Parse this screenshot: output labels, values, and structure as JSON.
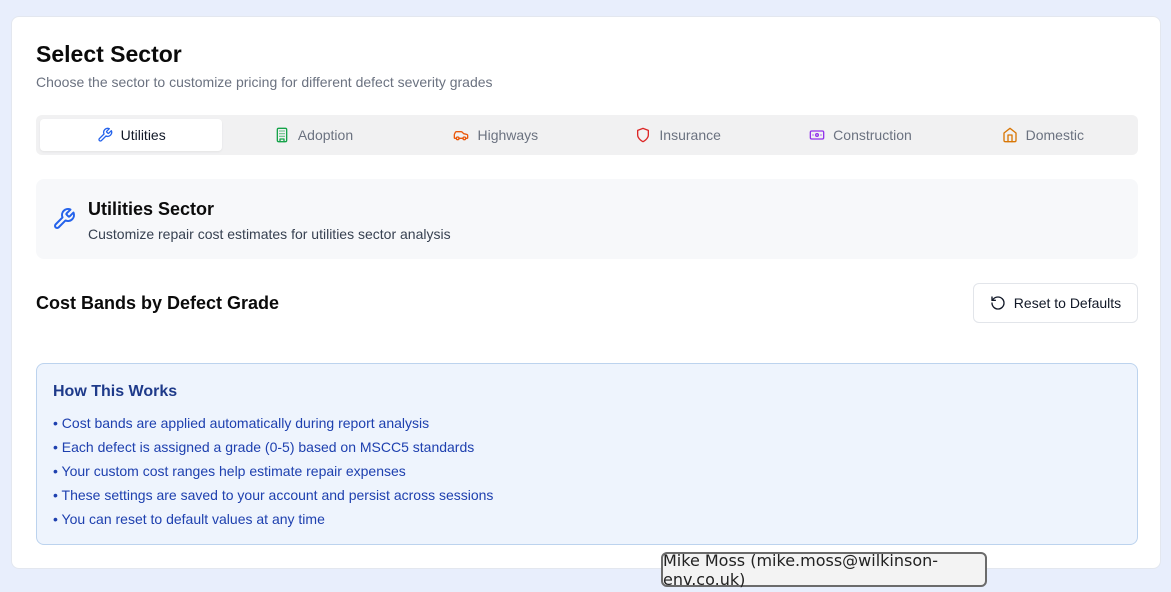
{
  "header": {
    "title": "Select Sector",
    "subtitle": "Choose the sector to customize pricing for different defect severity grades"
  },
  "tabs": [
    {
      "label": "Utilities",
      "icon": "wrench-icon",
      "color": "#2563eb",
      "active": true
    },
    {
      "label": "Adoption",
      "icon": "building-icon",
      "color": "#16a34a",
      "active": false
    },
    {
      "label": "Highways",
      "icon": "car-icon",
      "color": "#ea580c",
      "active": false
    },
    {
      "label": "Insurance",
      "icon": "shield-icon",
      "color": "#dc2626",
      "active": false
    },
    {
      "label": "Construction",
      "icon": "banknote-icon",
      "color": "#9333ea",
      "active": false
    },
    {
      "label": "Domestic",
      "icon": "home-icon",
      "color": "#d97706",
      "active": false
    }
  ],
  "sector": {
    "icon": "wrench-icon",
    "title": "Utilities Sector",
    "description": "Customize repair cost estimates for utilities sector analysis"
  },
  "cost_bands": {
    "title": "Cost Bands by Defect Grade",
    "reset_label": "Reset to Defaults",
    "reset_icon": "rotate-ccw-icon"
  },
  "info": {
    "title": "How This Works",
    "items": [
      "• Cost bands are applied automatically during report analysis",
      "• Each defect is assigned a grade (0-5) based on MSCC5 standards",
      "• Your custom cost ranges help estimate repair expenses",
      "• These settings are saved to your account and persist across sessions",
      "• You can reset to default values at any time"
    ]
  },
  "tooltip": {
    "text": "Mike Moss (mike.moss@wilkinson-env.co.uk)"
  }
}
